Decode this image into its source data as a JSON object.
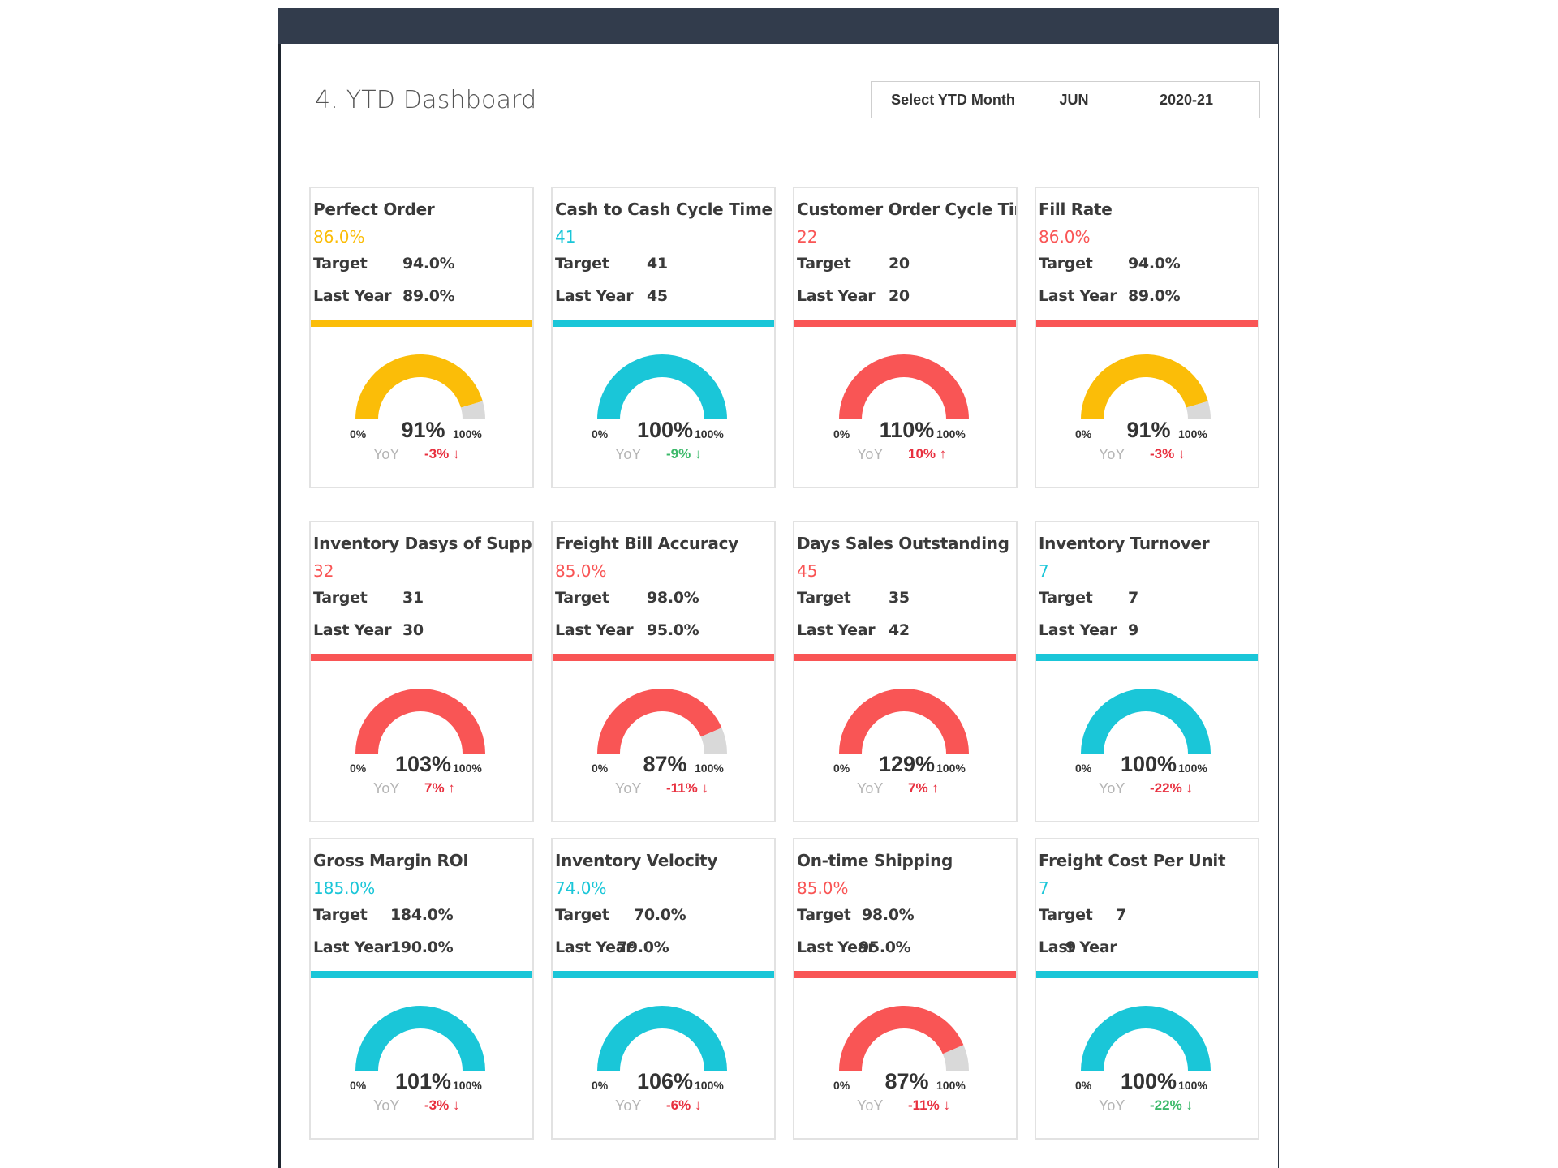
{
  "page": {
    "title": "4. YTD Dashboard",
    "selector": {
      "label": "Select YTD Month",
      "month": "JUN",
      "year": "2020-21"
    }
  },
  "colors": {
    "header_bar": "#323c4c",
    "yellow": "#fbbd08",
    "teal": "#1ac6d8",
    "red": "#f95555",
    "gauge_remainder": "#d9d9d9",
    "yoy_bad": "#e8303f",
    "yoy_good": "#3cb96a"
  },
  "gauge_labels": {
    "min": "0%",
    "max": "100%",
    "yoy": "YoY"
  },
  "row_labels": {
    "target": "Target",
    "last_year": "Last Year"
  },
  "kpis": [
    {
      "name": "Perfect Order",
      "actual": "86.0%",
      "target": "94.0%",
      "last_year": "89.0%",
      "status": "yellow",
      "gauge_pct": 91,
      "gauge_label": "91%",
      "yoy": "-3% ↓",
      "yoy_status": "bad"
    },
    {
      "name": "Cash to Cash Cycle Time",
      "actual": "41",
      "target": "41",
      "last_year": "45",
      "status": "teal",
      "gauge_pct": 100,
      "gauge_label": "100%",
      "yoy": "-9% ↓",
      "yoy_status": "good"
    },
    {
      "name": "Customer Order Cycle Time",
      "actual": "22",
      "target": "20",
      "last_year": "20",
      "status": "red",
      "gauge_pct": 110,
      "gauge_label": "110%",
      "yoy": "10% ↑",
      "yoy_status": "bad"
    },
    {
      "name": "Fill Rate",
      "actual": "86.0%",
      "target": "94.0%",
      "last_year": "89.0%",
      "status": "red",
      "gauge_status": "yellow",
      "gauge_pct": 91,
      "gauge_label": "91%",
      "yoy": "-3% ↓",
      "yoy_status": "bad"
    },
    {
      "name": "Inventory Dasys of Supply",
      "actual": "32",
      "target": "31",
      "last_year": "30",
      "status": "red",
      "gauge_pct": 103,
      "gauge_label": "103%",
      "yoy": "7% ↑",
      "yoy_status": "bad"
    },
    {
      "name": "Freight Bill Accuracy",
      "actual": "85.0%",
      "target": "98.0%",
      "last_year": "95.0%",
      "status": "red",
      "gauge_pct": 87,
      "gauge_label": "87%",
      "yoy": "-11% ↓",
      "yoy_status": "bad"
    },
    {
      "name": "Days Sales Outstanding",
      "actual": "45",
      "target": "35",
      "last_year": "42",
      "status": "red",
      "gauge_pct": 129,
      "gauge_label": "129%",
      "yoy": "7% ↑",
      "yoy_status": "bad"
    },
    {
      "name": "Inventory Turnover",
      "actual": "7",
      "target": "7",
      "last_year": "9",
      "status": "teal",
      "gauge_pct": 100,
      "gauge_label": "100%",
      "yoy": "-22% ↓",
      "yoy_status": "bad"
    },
    {
      "name": "Gross Margin ROI",
      "actual": "185.0%",
      "target": "184.0%",
      "last_year": "190.0%",
      "status": "teal",
      "gauge_pct": 101,
      "gauge_label": "101%",
      "yoy": "-3% ↓",
      "yoy_status": "bad"
    },
    {
      "name": "Inventory Velocity",
      "actual": "74.0%",
      "target": "70.0%",
      "last_year": "79.0%",
      "status": "teal",
      "gauge_pct": 106,
      "gauge_label": "106%",
      "yoy": "-6% ↓",
      "yoy_status": "bad"
    },
    {
      "name": "On-time Shipping",
      "actual": "85.0%",
      "target": "98.0%",
      "last_year": "95.0%",
      "status": "red",
      "gauge_pct": 87,
      "gauge_label": "87%",
      "yoy": "-11% ↓",
      "yoy_status": "bad"
    },
    {
      "name": "Freight Cost Per Unit",
      "actual": "7",
      "target": "7",
      "last_year": "9",
      "status": "teal",
      "gauge_pct": 100,
      "gauge_label": "100%",
      "yoy": "-22% ↓",
      "yoy_status": "good"
    }
  ]
}
